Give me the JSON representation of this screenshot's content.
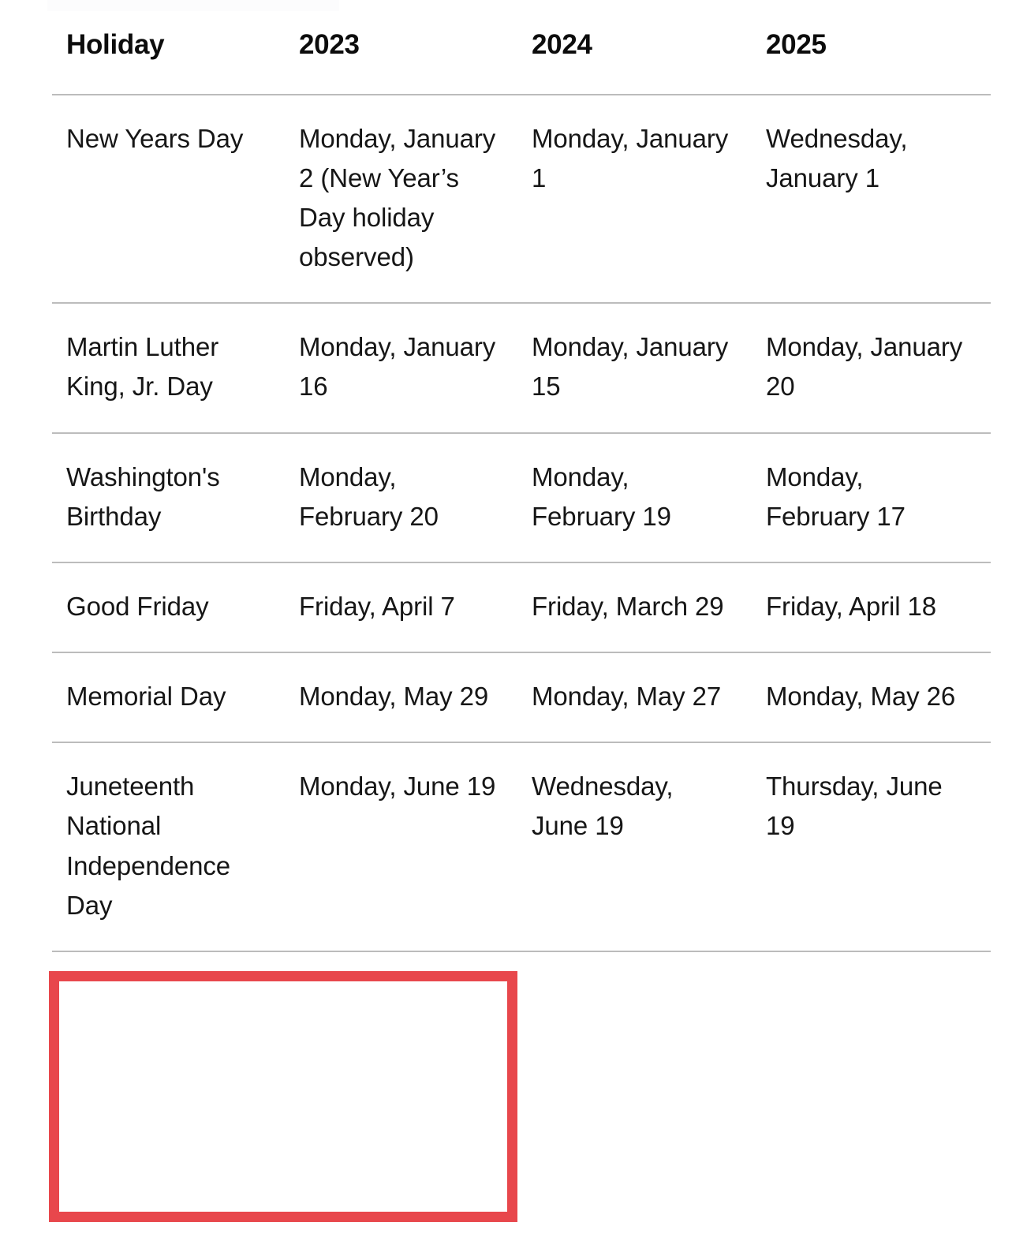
{
  "table": {
    "columns": [
      {
        "key": "holiday",
        "label": "Holiday"
      },
      {
        "key": "y2023",
        "label": "2023"
      },
      {
        "key": "y2024",
        "label": "2024"
      },
      {
        "key": "y2025",
        "label": "2025"
      }
    ],
    "rows": [
      {
        "holiday": "New Years Day",
        "y2023": "Monday, January 2 (New Year’s Day holiday observed)",
        "y2024": "Monday, January 1",
        "y2025": "Wednesday, January 1"
      },
      {
        "holiday": "Martin Luther King, Jr. Day",
        "y2023": "Monday, January 16",
        "y2024": "Monday, January 15",
        "y2025": "Monday, January 20"
      },
      {
        "holiday": "Washington's Birthday",
        "y2023": "Monday, February 20",
        "y2024": "Monday, February 19",
        "y2025": "Monday, February 17"
      },
      {
        "holiday": "Good Friday",
        "y2023": "Friday, April 7",
        "y2024": "Friday, March 29",
        "y2025": "Friday, April 18"
      },
      {
        "holiday": "Memorial Day",
        "y2023": "Monday, May 29",
        "y2024": "Monday, May 27",
        "y2025": "Monday, May 26"
      },
      {
        "holiday": "Juneteenth National Independence Day",
        "y2023": "Monday, June 19",
        "y2024": "Wednesday, June 19",
        "y2025": "Thursday, June 19"
      }
    ]
  },
  "annotation": {
    "type": "rectangle-highlight",
    "color": "#e8474c",
    "target_row": "Juneteenth National Independence Day",
    "covers_columns": [
      "Holiday",
      "2023"
    ]
  },
  "style": {
    "divider_color": "#bcbcbc",
    "text_color": "#161616",
    "background": "#ffffff"
  }
}
